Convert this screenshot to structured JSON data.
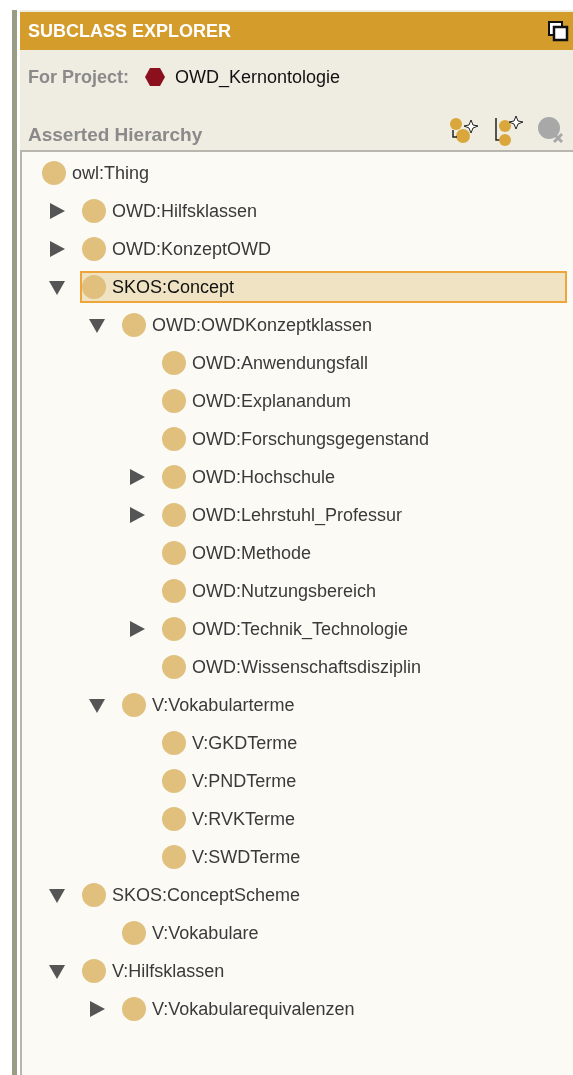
{
  "panel": {
    "title": "SUBCLASS EXPLORER"
  },
  "project": {
    "label": "For Project:",
    "name": "OWD_Kernontologie"
  },
  "hierarchy": {
    "title": "Asserted Hierarchy",
    "toolbar": [
      {
        "kind": "add-subclass",
        "disabled": false
      },
      {
        "kind": "add-sibling",
        "disabled": false
      },
      {
        "kind": "delete",
        "disabled": true
      }
    ]
  },
  "tree": {
    "label": "owl:Thing",
    "selected": false,
    "children": [
      {
        "label": "OWD:Hilfsklassen",
        "selected": false,
        "expanded": false
      },
      {
        "label": "OWD:KonzeptOWD",
        "selected": false,
        "expanded": false
      },
      {
        "label": "SKOS:Concept",
        "selected": true,
        "expanded": true,
        "children": [
          {
            "label": "OWD:OWDKonzeptklassen",
            "selected": false,
            "expanded": true,
            "children": [
              {
                "label": "OWD:Anwendungsfall",
                "selected": false
              },
              {
                "label": "OWD:Explanandum",
                "selected": false
              },
              {
                "label": "OWD:Forschungsgegenstand",
                "selected": false
              },
              {
                "label": "OWD:Hochschule",
                "selected": false,
                "expanded": false
              },
              {
                "label": "OWD:Lehrstuhl_Professur",
                "selected": false,
                "expanded": false
              },
              {
                "label": "OWD:Methode",
                "selected": false
              },
              {
                "label": "OWD:Nutzungsbereich",
                "selected": false
              },
              {
                "label": "OWD:Technik_Technologie",
                "selected": false,
                "expanded": false
              },
              {
                "label": "OWD:Wissenschaftsdisziplin",
                "selected": false
              }
            ]
          },
          {
            "label": "V:Vokabularterme",
            "selected": false,
            "expanded": true,
            "children": [
              {
                "label": "V:GKDTerme",
                "selected": false
              },
              {
                "label": "V:PNDTerme",
                "selected": false
              },
              {
                "label": "V:RVKTerme",
                "selected": false
              },
              {
                "label": "V:SWDTerme",
                "selected": false
              }
            ]
          }
        ]
      },
      {
        "label": "SKOS:ConceptScheme",
        "selected": false,
        "expanded": true,
        "children": [
          {
            "label": "V:Vokabulare",
            "selected": false
          }
        ]
      },
      {
        "label": "V:Hilfsklassen",
        "selected": false,
        "expanded": true,
        "children": [
          {
            "label": "V:Vokabularequivalenzen",
            "selected": false,
            "expanded": false
          }
        ]
      }
    ]
  }
}
